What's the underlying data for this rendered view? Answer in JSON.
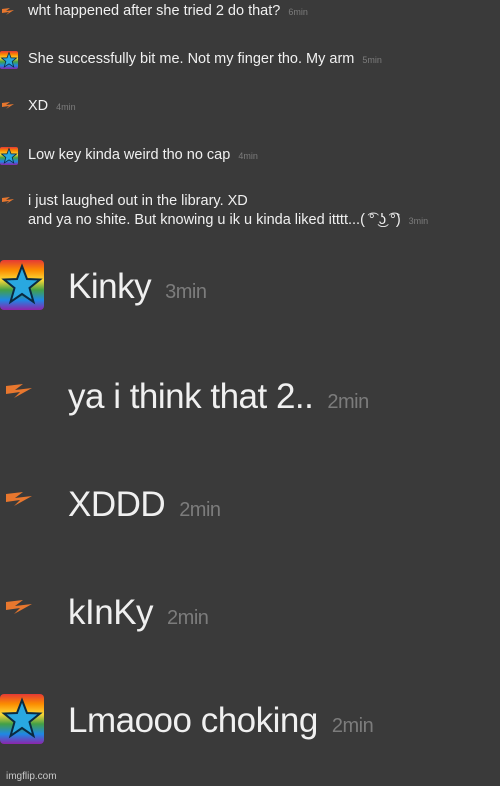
{
  "messages": [
    {
      "user": "lightning",
      "text": "wht happened after she tried 2 do that?",
      "time": "6min"
    },
    {
      "user": "rainbow-star",
      "text": "She successfully bit me. Not my finger tho. My arm",
      "time": "5min"
    },
    {
      "user": "lightning",
      "text": "XD",
      "time": "4min"
    },
    {
      "user": "rainbow-star",
      "text": "Low key kinda weird tho no cap",
      "time": "4min"
    },
    {
      "user": "lightning",
      "text_line1": "i just laughed out in the library. XD",
      "text_line2": "and ya no shite. But knowing u ik u kinda liked itttt...( ͡° ͜ʖ ͡°)",
      "time": "3min"
    },
    {
      "user": "rainbow-star",
      "text": "Kinky",
      "time": "3min"
    },
    {
      "user": "lightning",
      "text": "ya i think that 2..",
      "time": "2min"
    },
    {
      "user": "lightning",
      "text": "XDDD",
      "time": "2min"
    },
    {
      "user": "lightning",
      "text": "kInKy",
      "time": "2min"
    },
    {
      "user": "rainbow-star",
      "text": "Lmaooo choking",
      "time": "2min"
    }
  ],
  "watermark": "imgflip.com"
}
